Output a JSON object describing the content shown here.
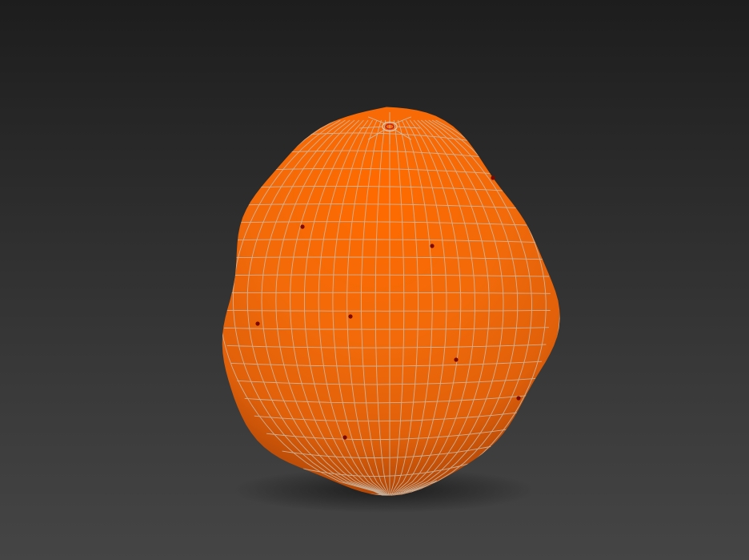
{
  "viewport": {
    "object": "mesh-object",
    "mesh_color": "#f26a0a",
    "wire_color": "#c9c0b0",
    "vertex_color": "#7a0a00",
    "background_top": "#1d1d1d",
    "background_bottom": "#454545"
  }
}
